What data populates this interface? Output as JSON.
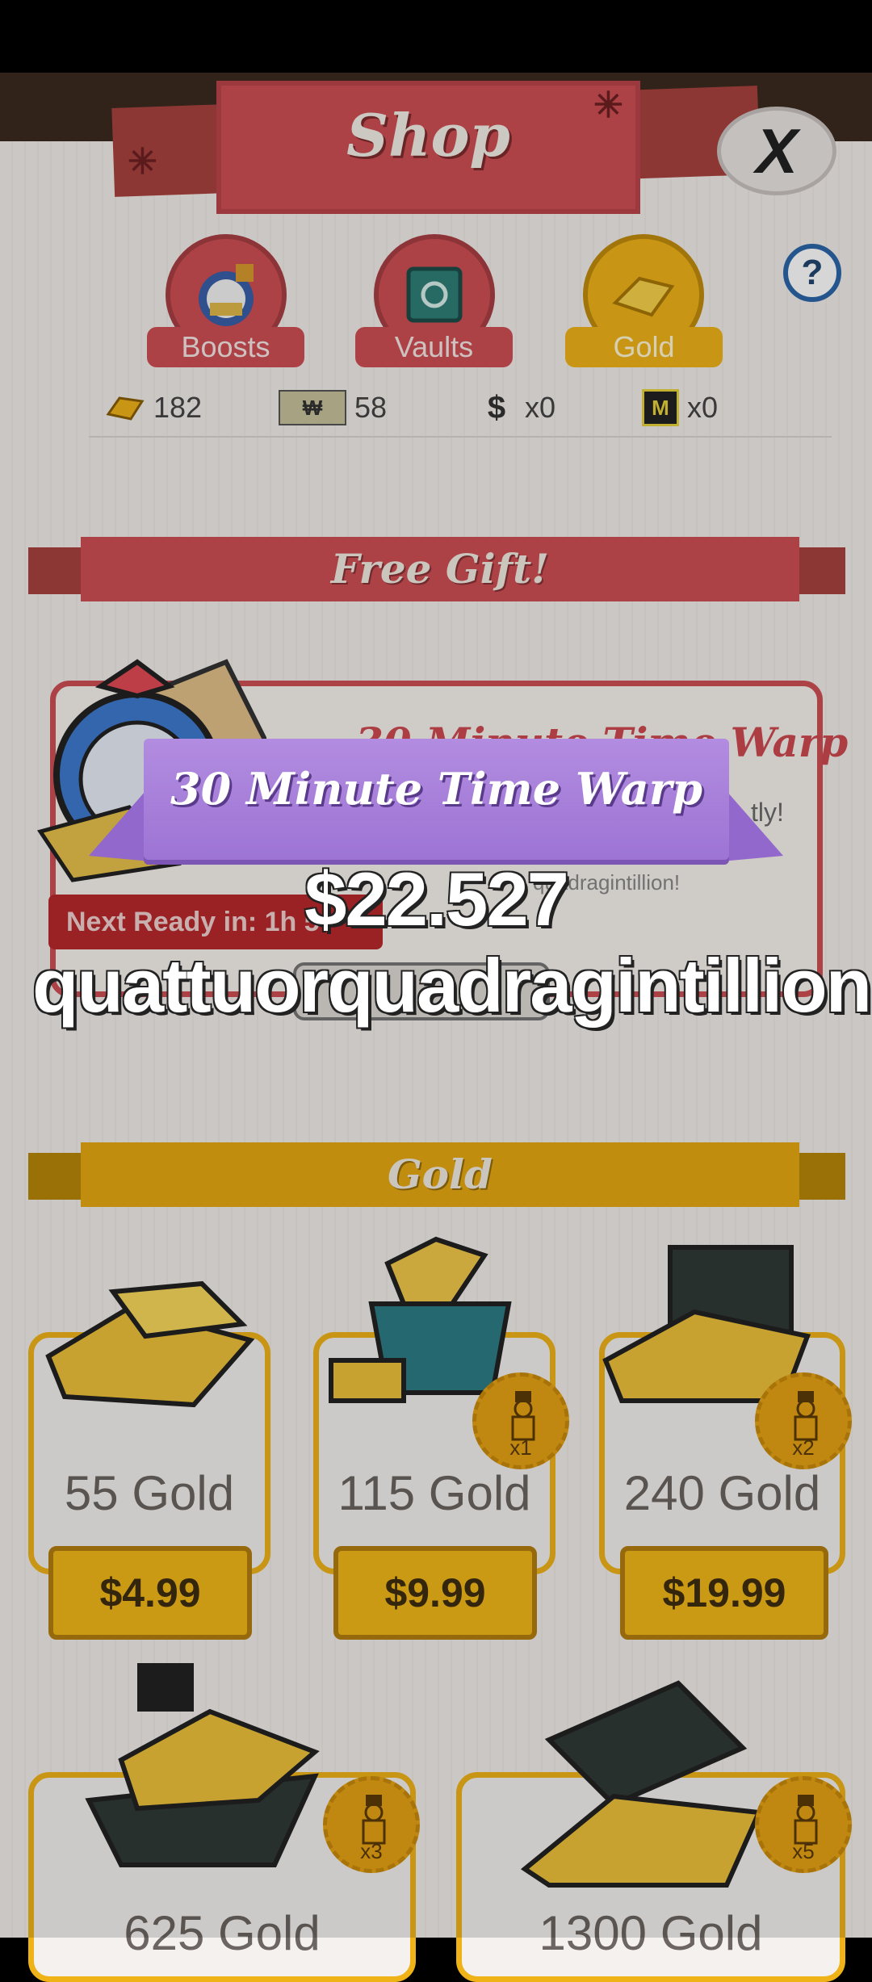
{
  "shop": {
    "title": "Shop",
    "close_label": "X",
    "help_label": "?",
    "tabs": [
      {
        "label": "Boosts",
        "color": "#cf4f54"
      },
      {
        "label": "Vaults",
        "color": "#cf4f54"
      },
      {
        "label": "Gold",
        "color": "#efb318"
      }
    ],
    "currencies": [
      {
        "icon": "gold-bar-icon",
        "value": "182"
      },
      {
        "icon": "mega-ticket-icon",
        "value": "58"
      },
      {
        "icon": "money-bag-icon",
        "value": "x0"
      },
      {
        "icon": "mega-badge-icon",
        "value": "x0"
      }
    ]
  },
  "free_gift": {
    "section_title": "Free Gift!",
    "item_title": "30 Minute Time Warp",
    "sub_line_1": "tly!",
    "sub_line_2": "quadragintillion!",
    "next_ready": "Next Ready in: 1h 5"
  },
  "gold": {
    "section_title": "Gold",
    "packs": [
      {
        "label": "55 Gold",
        "price": "$4.99",
        "badge": ""
      },
      {
        "label": "115 Gold",
        "price": "$9.99",
        "badge": "x1"
      },
      {
        "label": "240 Gold",
        "price": "$19.99",
        "badge": "x2"
      },
      {
        "label": "625 Gold",
        "price": "",
        "badge": "x3"
      },
      {
        "label": "1300 Gold",
        "price": "",
        "badge": "x5"
      }
    ]
  },
  "popup": {
    "title": "30 Minute Time Warp",
    "amount_line_1": "$22.527",
    "amount_line_2": "quattuorquadragintillion"
  },
  "colors": {
    "red": "#cf4f54",
    "gold": "#efb318",
    "purple": "#a07ad8"
  }
}
